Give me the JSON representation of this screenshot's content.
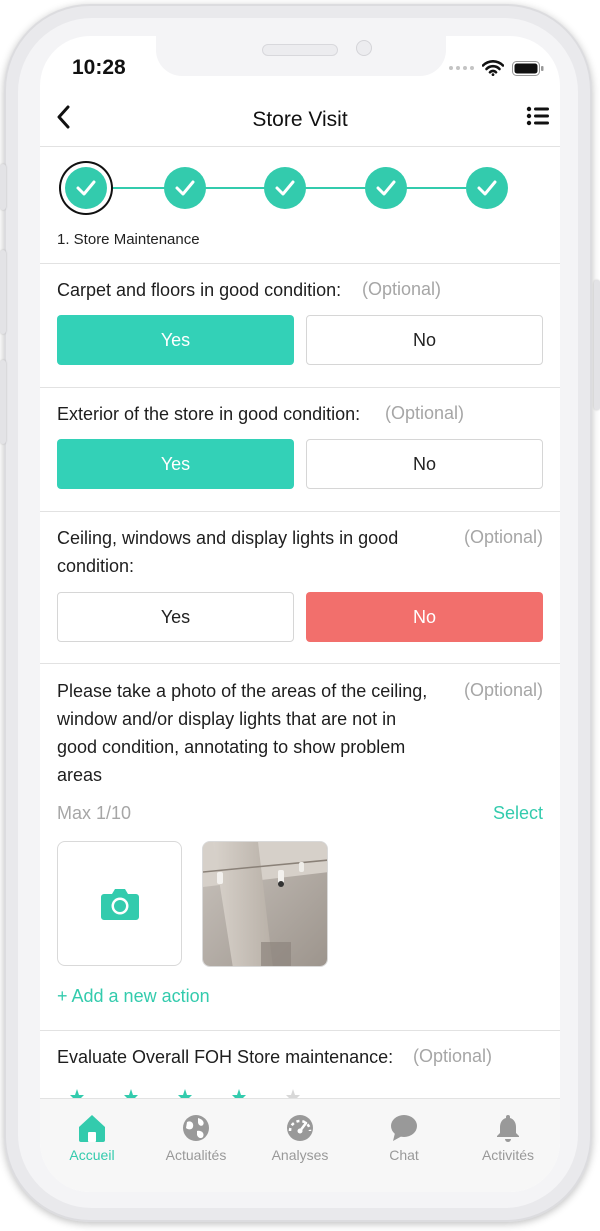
{
  "status_bar": {
    "time": "10:28"
  },
  "header": {
    "title": "Store Visit"
  },
  "stepper": {
    "current_step_label": "1. Store Maintenance",
    "steps_count": 5
  },
  "questions": [
    {
      "text": "Carpet and floors in good condition:",
      "optional": "(Optional)",
      "yes": "Yes",
      "no": "No",
      "answer": "Yes"
    },
    {
      "text": "Exterior of the store in good condition:",
      "optional": "(Optional)",
      "yes": "Yes",
      "no": "No",
      "answer": "Yes"
    },
    {
      "text_line1": "Ceiling, windows and display lights in good",
      "text_line2": "condition:",
      "optional": "(Optional)",
      "yes": "Yes",
      "no": "No",
      "answer": "No"
    }
  ],
  "photo_question": {
    "line1": "Please take a photo of the areas of the ceiling,",
    "line2": "window and/or display lights that are not in",
    "line3": "good condition, annotating to show problem",
    "line4": "areas",
    "optional": "(Optional)",
    "max": "Max 1/10",
    "select": "Select",
    "add_action": "+ Add a new action"
  },
  "evaluate": {
    "text": "Evaluate Overall FOH Store maintenance:",
    "optional": "(Optional)"
  },
  "tabs": [
    {
      "label": "Accueil",
      "icon": "home-icon",
      "active": true
    },
    {
      "label": "Actualités",
      "icon": "globe-icon",
      "active": false
    },
    {
      "label": "Analyses",
      "icon": "speedometer-icon",
      "active": false
    },
    {
      "label": "Chat",
      "icon": "chat-bubble-icon",
      "active": false
    },
    {
      "label": "Activités",
      "icon": "bell-icon",
      "active": false
    }
  ],
  "colors": {
    "accent": "#33cbad",
    "yes_selected": "#33d1b7",
    "no_selected": "#f26f6c"
  }
}
